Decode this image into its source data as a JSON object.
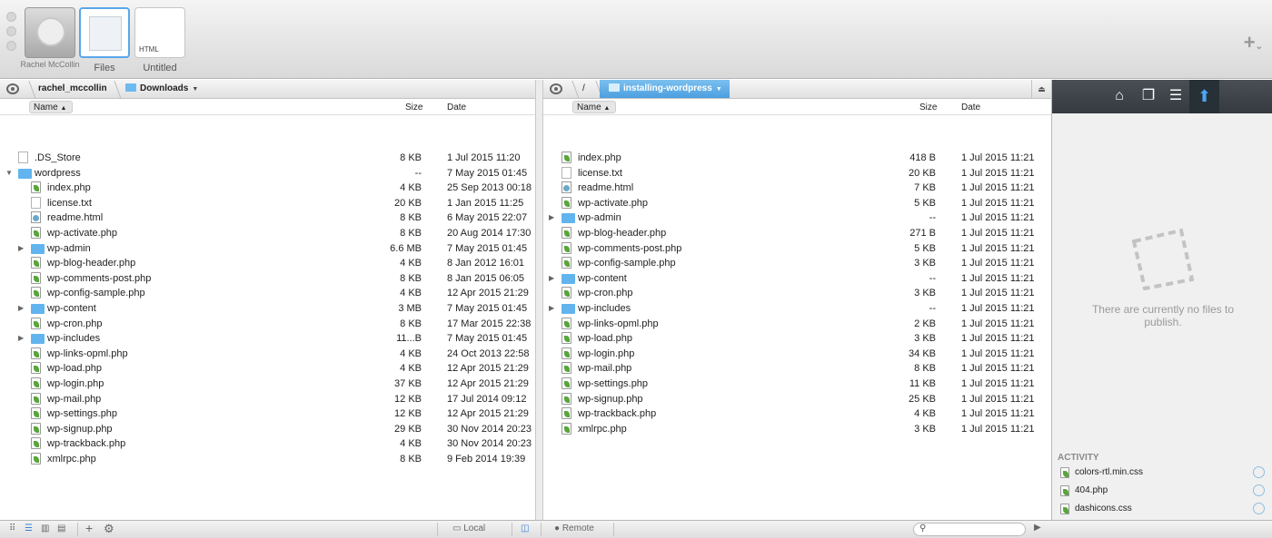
{
  "toolbar": {
    "tiles": [
      {
        "label": "Rachel McCollin"
      },
      {
        "label": "Files"
      },
      {
        "label": "Untitled",
        "badge": "HTML"
      }
    ]
  },
  "left": {
    "crumb_user": "rachel_mccollin",
    "crumb_folder": "Downloads",
    "col_name": "Name",
    "col_size": "Size",
    "col_date": "Date",
    "rows": [
      {
        "name": ".DS_Store",
        "size": "8 KB",
        "date": "1 Jul 2015 11:20"
      },
      {
        "name": "wordpress",
        "size": "--",
        "date": "7 May 2015 01:45"
      },
      {
        "name": "index.php",
        "size": "4 KB",
        "date": "25 Sep 2013 00:18"
      },
      {
        "name": "license.txt",
        "size": "20 KB",
        "date": "1 Jan 2015 11:25"
      },
      {
        "name": "readme.html",
        "size": "8 KB",
        "date": "6 May 2015 22:07"
      },
      {
        "name": "wp-activate.php",
        "size": "8 KB",
        "date": "20 Aug 2014 17:30"
      },
      {
        "name": "wp-admin",
        "size": "6.6 MB",
        "date": "7 May 2015 01:45"
      },
      {
        "name": "wp-blog-header.php",
        "size": "4 KB",
        "date": "8 Jan 2012 16:01"
      },
      {
        "name": "wp-comments-post.php",
        "size": "8 KB",
        "date": "8 Jan 2015 06:05"
      },
      {
        "name": "wp-config-sample.php",
        "size": "4 KB",
        "date": "12 Apr 2015 21:29"
      },
      {
        "name": "wp-content",
        "size": "3 MB",
        "date": "7 May 2015 01:45"
      },
      {
        "name": "wp-cron.php",
        "size": "8 KB",
        "date": "17 Mar 2015 22:38"
      },
      {
        "name": "wp-includes",
        "size": "11...B",
        "date": "7 May 2015 01:45"
      },
      {
        "name": "wp-links-opml.php",
        "size": "4 KB",
        "date": "24 Oct 2013 22:58"
      },
      {
        "name": "wp-load.php",
        "size": "4 KB",
        "date": "12 Apr 2015 21:29"
      },
      {
        "name": "wp-login.php",
        "size": "37 KB",
        "date": "12 Apr 2015 21:29"
      },
      {
        "name": "wp-mail.php",
        "size": "12 KB",
        "date": "17 Jul 2014 09:12"
      },
      {
        "name": "wp-settings.php",
        "size": "12 KB",
        "date": "12 Apr 2015 21:29"
      },
      {
        "name": "wp-signup.php",
        "size": "29 KB",
        "date": "30 Nov 2014 20:23"
      },
      {
        "name": "wp-trackback.php",
        "size": "4 KB",
        "date": "30 Nov 2014 20:23"
      },
      {
        "name": "xmlrpc.php",
        "size": "8 KB",
        "date": "9 Feb 2014 19:39"
      }
    ]
  },
  "right": {
    "crumb_root": "/",
    "crumb_folder": "installing-wordpress",
    "col_name": "Name",
    "col_size": "Size",
    "col_date": "Date",
    "rows": [
      {
        "name": "index.php",
        "size": "418 B",
        "date": "1 Jul 2015 11:21"
      },
      {
        "name": "license.txt",
        "size": "20 KB",
        "date": "1 Jul 2015 11:21"
      },
      {
        "name": "readme.html",
        "size": "7 KB",
        "date": "1 Jul 2015 11:21"
      },
      {
        "name": "wp-activate.php",
        "size": "5 KB",
        "date": "1 Jul 2015 11:21"
      },
      {
        "name": "wp-admin",
        "size": "--",
        "date": "1 Jul 2015 11:21"
      },
      {
        "name": "wp-blog-header.php",
        "size": "271 B",
        "date": "1 Jul 2015 11:21"
      },
      {
        "name": "wp-comments-post.php",
        "size": "5 KB",
        "date": "1 Jul 2015 11:21"
      },
      {
        "name": "wp-config-sample.php",
        "size": "3 KB",
        "date": "1 Jul 2015 11:21"
      },
      {
        "name": "wp-content",
        "size": "--",
        "date": "1 Jul 2015 11:21"
      },
      {
        "name": "wp-cron.php",
        "size": "3 KB",
        "date": "1 Jul 2015 11:21"
      },
      {
        "name": "wp-includes",
        "size": "--",
        "date": "1 Jul 2015 11:21"
      },
      {
        "name": "wp-links-opml.php",
        "size": "2 KB",
        "date": "1 Jul 2015 11:21"
      },
      {
        "name": "wp-load.php",
        "size": "3 KB",
        "date": "1 Jul 2015 11:21"
      },
      {
        "name": "wp-login.php",
        "size": "34 KB",
        "date": "1 Jul 2015 11:21"
      },
      {
        "name": "wp-mail.php",
        "size": "8 KB",
        "date": "1 Jul 2015 11:21"
      },
      {
        "name": "wp-settings.php",
        "size": "11 KB",
        "date": "1 Jul 2015 11:21"
      },
      {
        "name": "wp-signup.php",
        "size": "25 KB",
        "date": "1 Jul 2015 11:21"
      },
      {
        "name": "wp-trackback.php",
        "size": "4 KB",
        "date": "1 Jul 2015 11:21"
      },
      {
        "name": "xmlrpc.php",
        "size": "3 KB",
        "date": "1 Jul 2015 11:21"
      }
    ]
  },
  "side": {
    "empty_message": "There are currently no files to publish.",
    "activity_title": "ACTIVITY",
    "activity": [
      {
        "name": "colors-rtl.min.css"
      },
      {
        "name": "404.php"
      },
      {
        "name": "dashicons.css"
      }
    ]
  },
  "bottom": {
    "local_label": "Local",
    "remote_label": "Remote"
  }
}
